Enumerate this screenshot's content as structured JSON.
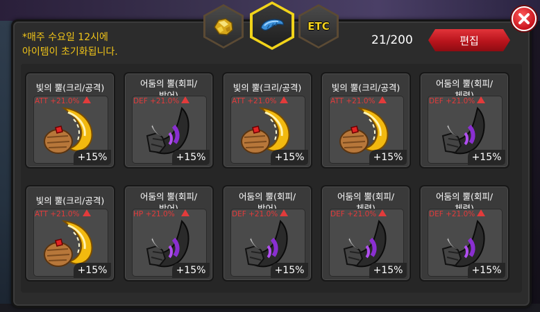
{
  "notice_lines": [
    "*매주 수요일 12시에",
    "아이템이 초기화됩니다."
  ],
  "counter": "21/200",
  "edit_label": "편집",
  "tabs": [
    {
      "icon": "gold-ore-icon",
      "label": "",
      "active": false
    },
    {
      "icon": "blue-horn-icon",
      "label": "",
      "active": true
    },
    {
      "icon": "etc-text",
      "label": "ETC",
      "active": false
    }
  ],
  "items": [
    {
      "name": "빛의 뿔(크리/공격)",
      "stat": "ATT +21.0%",
      "bonus": "+15%",
      "type": "light"
    },
    {
      "name": "어둠의 뿔(회피/방어)",
      "stat": "DEF +21.0%",
      "bonus": "+15%",
      "type": "dark"
    },
    {
      "name": "빛의 뿔(크리/공격)",
      "stat": "ATT +21.0%",
      "bonus": "+15%",
      "type": "light"
    },
    {
      "name": "빛의 뿔(크리/공격)",
      "stat": "ATT +21.0%",
      "bonus": "+15%",
      "type": "light"
    },
    {
      "name": "어둠의 뿔(회피/체력)",
      "stat": "DEF +21.0%",
      "bonus": "+15%",
      "type": "dark"
    },
    {
      "name": "빛의 뿔(크리/공격)",
      "stat": "ATT +21.0%",
      "bonus": "+15%",
      "type": "light"
    },
    {
      "name": "어둠의 뿔(회피/방어)",
      "stat": "HP +21.0%",
      "bonus": "+15%",
      "type": "dark"
    },
    {
      "name": "어둠의 뿔(회피/방어)",
      "stat": "DEF +21.0%",
      "bonus": "+15%",
      "type": "dark"
    },
    {
      "name": "어둠의 뿔(회피/체력)",
      "stat": "DEF +21.0%",
      "bonus": "+15%",
      "type": "dark"
    },
    {
      "name": "어둠의 뿔(회피/체력)",
      "stat": "DEF +21.0%",
      "bonus": "+15%",
      "type": "dark"
    }
  ],
  "colors": {
    "accent_yellow": "#f1d31a",
    "stat_red": "#e23b3b",
    "edit_red": "#c8131c"
  }
}
